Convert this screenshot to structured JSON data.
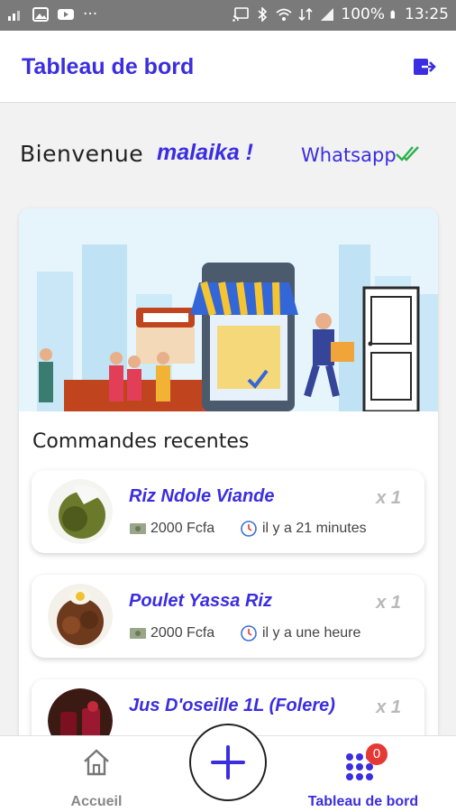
{
  "status_bar": {
    "battery": "100%",
    "time": "13:25"
  },
  "app_bar": {
    "title": "Tableau de bord"
  },
  "welcome": {
    "greeting": "Bienvenue",
    "user": "malaika !",
    "whatsapp": "Whatsapp"
  },
  "recent": {
    "title": "Commandes recentes",
    "orders": [
      {
        "name": "Riz Ndole Viande",
        "qty": "x 1",
        "price": "2000 Fcfa",
        "time": "il y a 21 minutes"
      },
      {
        "name": "Poulet Yassa Riz",
        "qty": "x 1",
        "price": "2000 Fcfa",
        "time": "il y a une heure"
      },
      {
        "name": "Jus D'oseille 1L (Folere)",
        "qty": "x 1"
      }
    ]
  },
  "bottom_nav": {
    "home": "Accueil",
    "dashboard": "Tableau de bord",
    "badge_count": "0"
  },
  "colors": {
    "accent": "#3b2de0",
    "badge": "#e53935",
    "status_bar": "#7a7a7a"
  },
  "icons": [
    "logout-icon",
    "double-check-icon",
    "money-icon",
    "clock-icon",
    "home-icon",
    "plus-icon",
    "grid-dots-icon"
  ]
}
